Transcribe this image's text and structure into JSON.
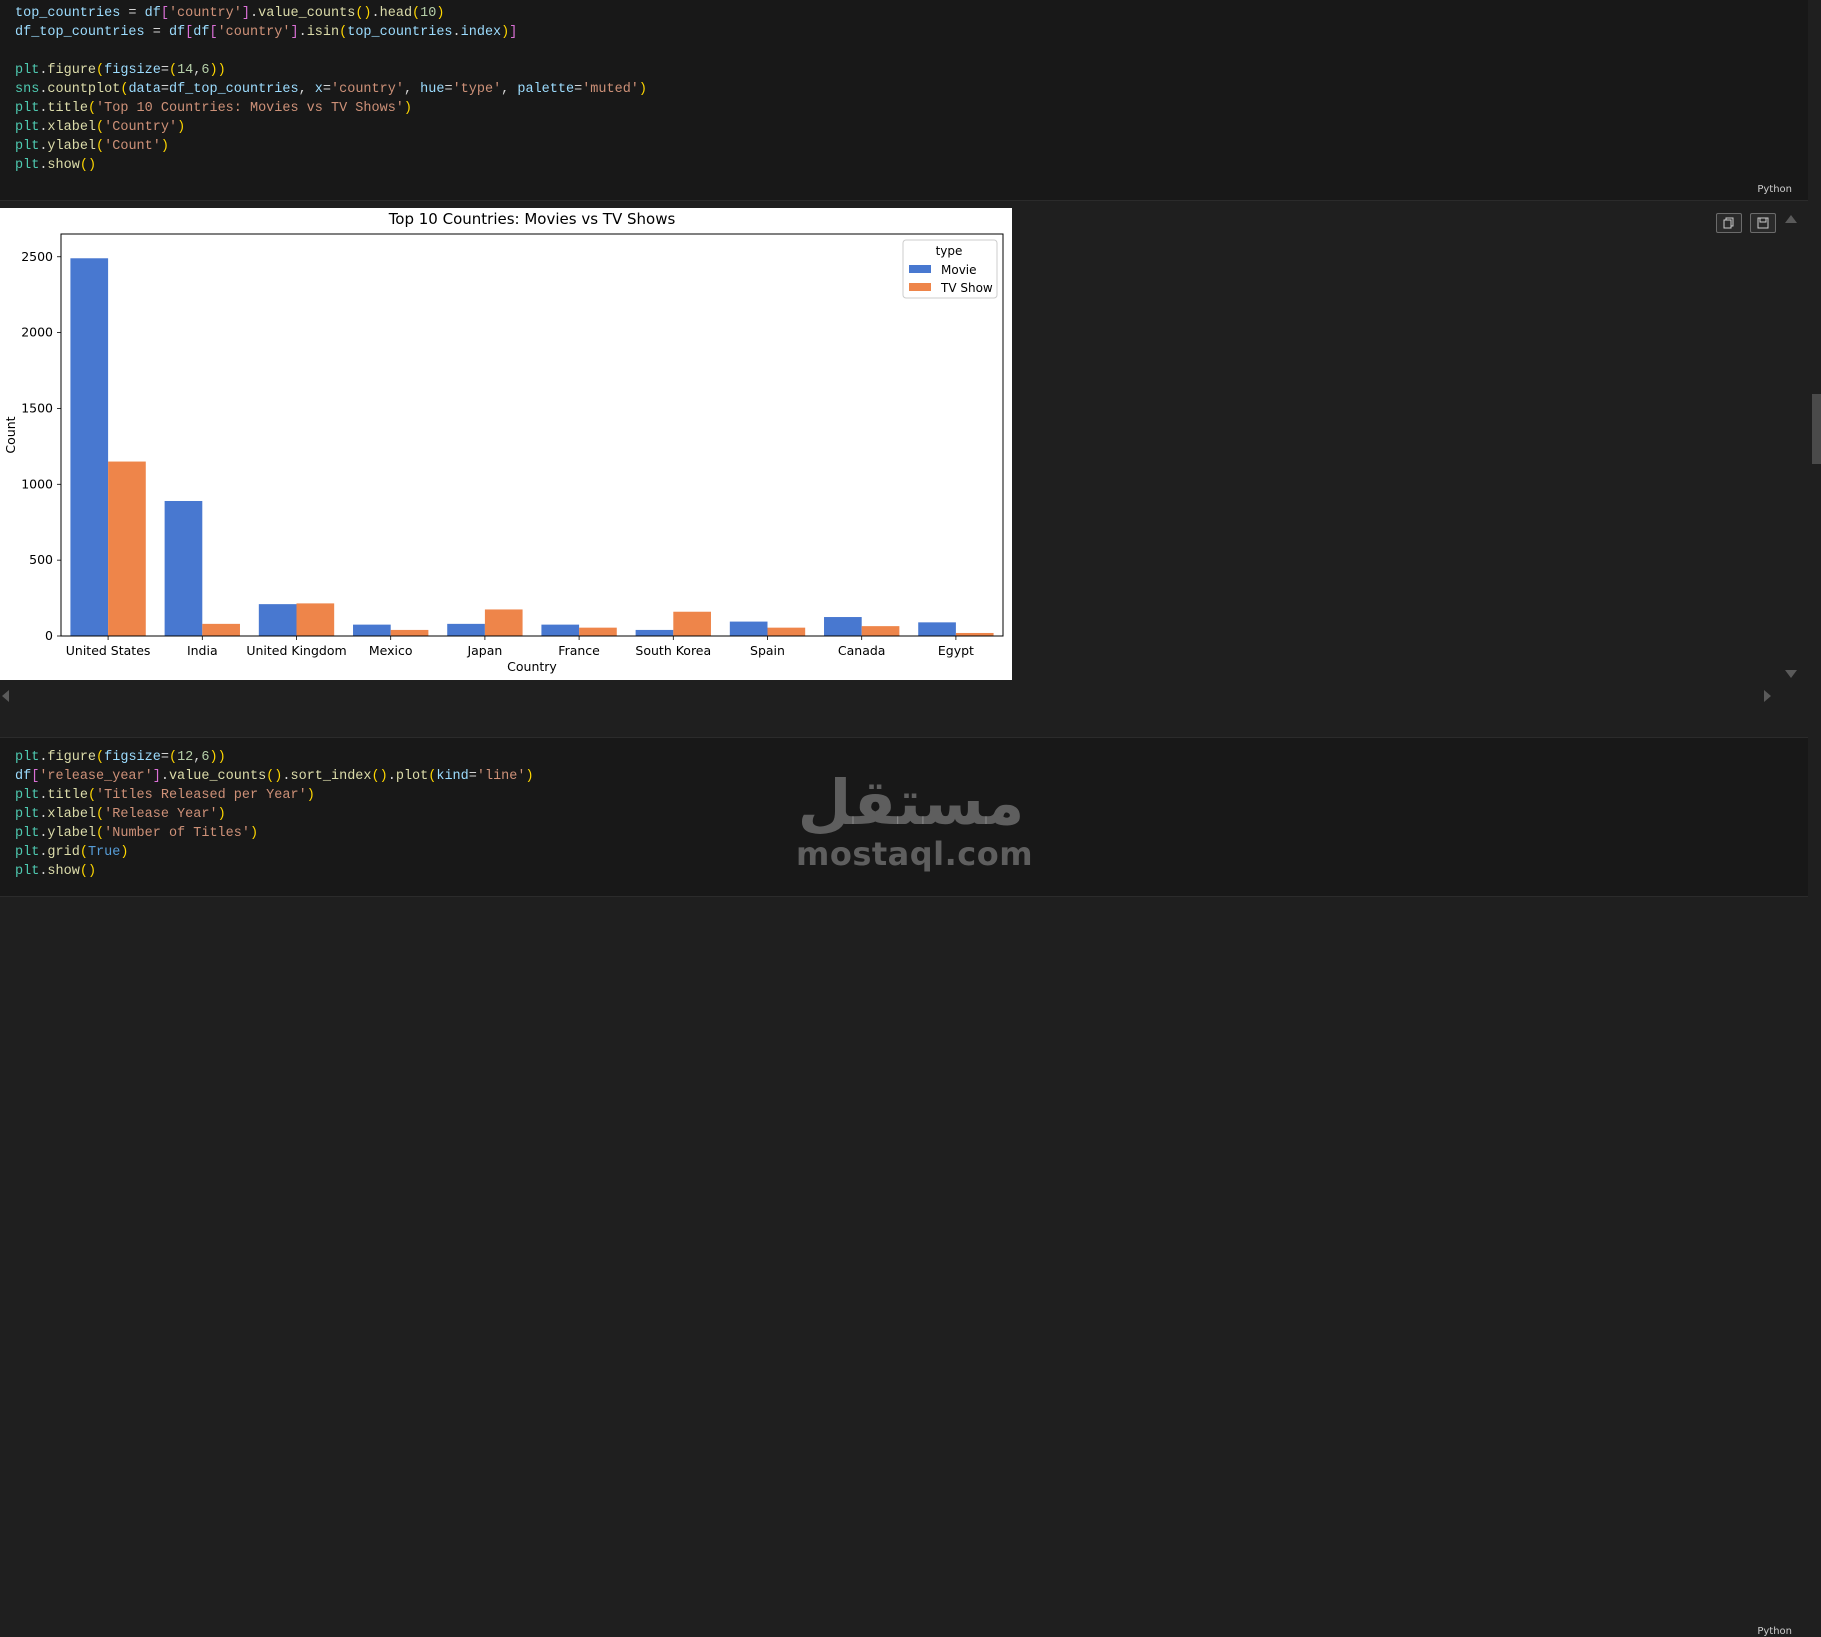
{
  "cell1": {
    "language": "Python",
    "code_lines": [
      "top_countries = df['country'].value_counts().head(10)",
      "df_top_countries = df[df['country'].isin(top_countries.index)]",
      "",
      "plt.figure(figsize=(14,6))",
      "sns.countplot(data=df_top_countries, x='country', hue='type', palette='muted')",
      "plt.title('Top 10 Countries: Movies vs TV Shows')",
      "plt.xlabel('Country')",
      "plt.ylabel('Count')",
      "plt.show()"
    ]
  },
  "cell2": {
    "language": "Python",
    "code_lines": [
      "plt.figure(figsize=(12,6))",
      "df['release_year'].value_counts().sort_index().plot(kind='line')",
      "plt.title('Titles Released per Year')",
      "plt.xlabel('Release Year')",
      "plt.ylabel('Number of Titles')",
      "plt.grid(True)",
      "plt.show()"
    ]
  },
  "watermark": {
    "arabic": "مستقل",
    "latin": "mostaql.com"
  },
  "chart_data": {
    "type": "bar",
    "title": "Top 10 Countries: Movies vs TV Shows",
    "xlabel": "Country",
    "ylabel": "Count",
    "categories": [
      "United States",
      "India",
      "United Kingdom",
      "Mexico",
      "Japan",
      "France",
      "South Korea",
      "Spain",
      "Canada",
      "Egypt"
    ],
    "series": [
      {
        "name": "Movie",
        "color": "#4878d0",
        "values": [
          2490,
          890,
          210,
          75,
          80,
          75,
          40,
          95,
          125,
          90
        ]
      },
      {
        "name": "TV Show",
        "color": "#ee854a",
        "values": [
          1150,
          80,
          215,
          40,
          175,
          55,
          160,
          55,
          65,
          20
        ]
      }
    ],
    "ylim": [
      0,
      2650
    ],
    "yticks": [
      0,
      500,
      1000,
      1500,
      2000,
      2500
    ],
    "legend": {
      "title": "type",
      "placement": "top-right"
    },
    "grid": false
  }
}
